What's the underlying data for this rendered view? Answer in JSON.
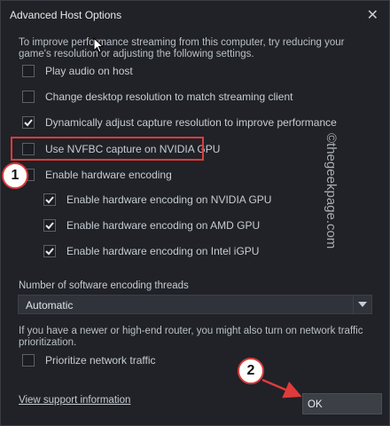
{
  "window": {
    "title": "Advanced Host Options",
    "close_glyph": "✕"
  },
  "intro_text": "To improve performance streaming from this computer, try reducing your game's resolution or adjusting the following settings.",
  "options": [
    {
      "label": "Play audio on host",
      "checked": false
    },
    {
      "label": "Change desktop resolution to match streaming client",
      "checked": false
    },
    {
      "label": "Dynamically adjust capture resolution to improve performance",
      "checked": true
    },
    {
      "label": "Use NVFBC capture on NVIDIA GPU",
      "checked": false
    },
    {
      "label": "Enable hardware encoding",
      "checked": false
    }
  ],
  "sub_options": [
    {
      "label": "Enable hardware encoding on NVIDIA GPU",
      "checked": true
    },
    {
      "label": "Enable hardware encoding on AMD GPU",
      "checked": true
    },
    {
      "label": "Enable hardware encoding on Intel iGPU",
      "checked": true
    }
  ],
  "threads": {
    "label": "Number of software encoding threads",
    "value": "Automatic"
  },
  "router_note": "If you have a newer or high-end router, you might also turn on network traffic prioritization.",
  "prioritize": {
    "label": "Prioritize network traffic",
    "checked": false
  },
  "support_link": "View support information",
  "ok_label": "OK",
  "annotations": {
    "badge_1": "1",
    "badge_2": "2",
    "watermark": "©thegeekpage.com"
  },
  "colors": {
    "highlight": "#e03b3b",
    "background": "#1f2126",
    "text": "#c6ccd4"
  }
}
